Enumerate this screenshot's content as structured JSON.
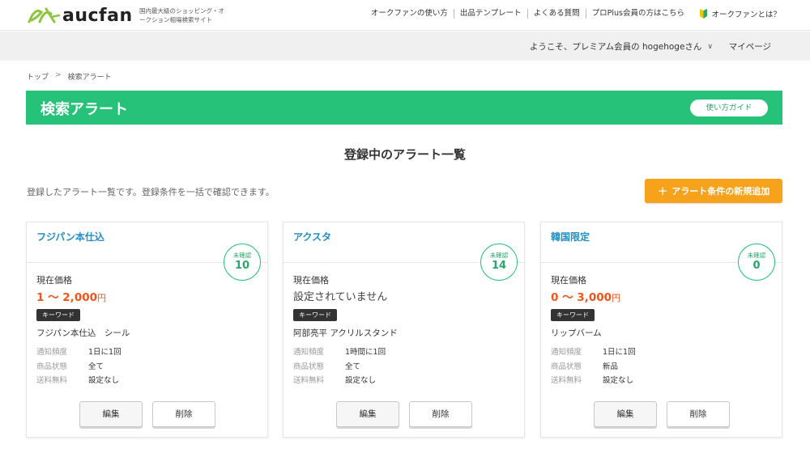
{
  "header": {
    "logo_text": "aucfan",
    "tagline": "国内最大級のショッピング・オークション相場検索サイト",
    "nav": [
      "オークファンの使い方",
      "出品テンプレート",
      "よくある質問",
      "プロPlus会員の方はこちら"
    ],
    "about": "オークファンとは？"
  },
  "userbar": {
    "welcome": "ようこそ、プレミアム会員の hogehogeさん",
    "mypage": "マイページ"
  },
  "breadcrumb": [
    "トップ",
    "検索アラート"
  ],
  "banner": {
    "title": "検索アラート",
    "guide_button": "使い方ガイド"
  },
  "main": {
    "section_title": "登録中のアラート一覧",
    "description": "登録したアラート一覧です。登録条件を一括で確認できます。",
    "add_button": "アラート条件の新規追加"
  },
  "card_labels": {
    "unread": "未確認",
    "price_label": "現在価格",
    "keyword_badge": "キーワード",
    "frequency": "通知頻度",
    "condition": "商品状態",
    "shipping": "送料無料",
    "edit": "編集",
    "delete": "削除",
    "unit": "円"
  },
  "cards": [
    {
      "title": "フジパン本仕込",
      "unread_count": "10",
      "price": "1 ～ 2,000",
      "keyword": "フジパン本仕込　シール",
      "frequency": "1日に1回",
      "condition": "全て",
      "shipping": "設定なし"
    },
    {
      "title": "アクスタ",
      "unread_count": "14",
      "price_none": "設定されていません",
      "keyword": "阿部亮平 アクリルスタンド",
      "frequency": "1時間に1回",
      "condition": "全て",
      "shipping": "設定なし"
    },
    {
      "title": "韓国限定",
      "unread_count": "0",
      "price": "0 ～ 3,000",
      "keyword": "リップバーム",
      "frequency": "1日に1回",
      "condition": "新品",
      "shipping": "設定なし"
    }
  ],
  "colors": {
    "brand_green": "#27c27a",
    "link_blue": "#1f8fc6",
    "price_orange": "#f2541b",
    "add_button": "#f7a21b"
  }
}
